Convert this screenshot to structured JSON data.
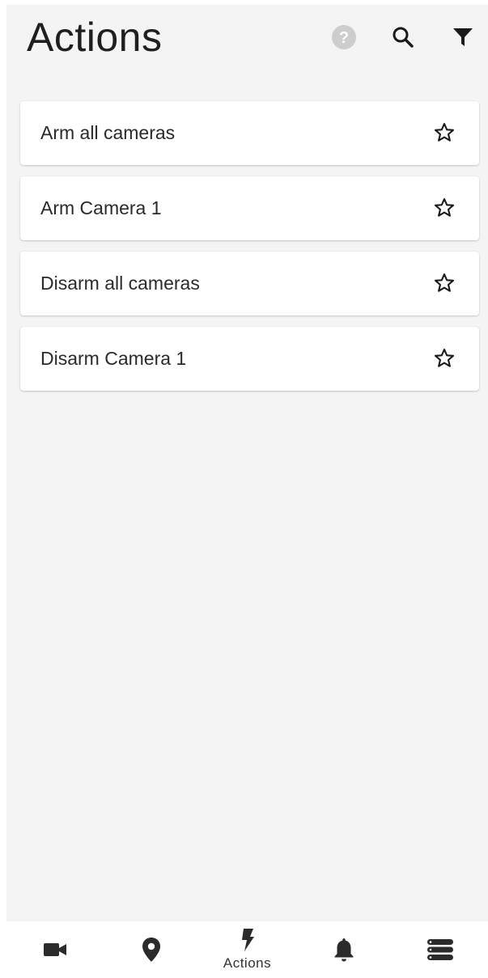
{
  "header": {
    "title": "Actions",
    "icons": [
      "help-icon",
      "search-icon",
      "filter-icon"
    ]
  },
  "actions": [
    {
      "label": "Arm all cameras",
      "favorite": false
    },
    {
      "label": "Arm Camera 1",
      "favorite": false
    },
    {
      "label": "Disarm all cameras",
      "favorite": false
    },
    {
      "label": "Disarm Camera 1",
      "favorite": false
    }
  ],
  "bottom_nav": {
    "items": [
      {
        "icon": "video-camera-icon",
        "label": ""
      },
      {
        "icon": "map-pin-icon",
        "label": ""
      },
      {
        "icon": "lightning-icon",
        "label": "Actions",
        "active": true
      },
      {
        "icon": "bell-icon",
        "label": ""
      },
      {
        "icon": "menu-stack-icon",
        "label": ""
      }
    ]
  },
  "colors": {
    "background": "#f4f4f4",
    "card": "#ffffff",
    "icon": "#222222",
    "help_icon": "#c8c8c8"
  }
}
